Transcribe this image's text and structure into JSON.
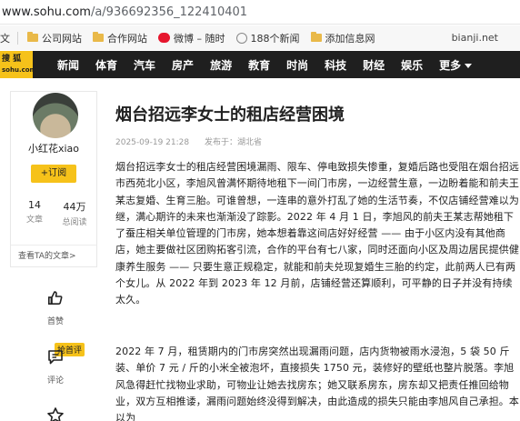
{
  "browser": {
    "address_host": "www.sohu.com",
    "address_path": "/a/936692356_122410401"
  },
  "bookmarks": {
    "left_cut": "文",
    "items": [
      "公司网站",
      "合作网站",
      "微博 – 随时",
      "188个新闻",
      "添加信息网"
    ],
    "right": "bianji.net"
  },
  "nav": {
    "logo_line1": "搜 狐",
    "logo_line2": "sohu.com",
    "links": [
      "新闻",
      "体育",
      "汽车",
      "房产",
      "旅游",
      "教育",
      "时尚",
      "科技",
      "财经",
      "娱乐",
      "更多"
    ]
  },
  "author": {
    "name": "小红花xiao",
    "follow": "+订阅",
    "articles_count": "14",
    "articles_label": "文章",
    "reads_count": "44万",
    "reads_label": "总阅读",
    "more_link": "查看TA的文章>"
  },
  "rail": {
    "like": "首赞",
    "comment_badge": "抢首评",
    "comment": "评论"
  },
  "article": {
    "title": "烟台招远李女士的租店经营困境",
    "date": "2025-09-19 21:28",
    "publisher": "发布于：湖北省",
    "paragraph1": "烟台招远李女士的租店经营困境漏雨、限车、停电致损失惨重，复婚后路也受阻在烟台招远市西苑北小区，李旭风曾满怀期待地租下一间门市房，一边经营生意，一边盼着能和前夫王某志复婚、生育三胎。可谁曾想，一连串的意外打乱了她的生活节奏，不仅店铺经营难以为继，满心期许的未来也渐渐没了踪影。2022 年 4 月 1 日，李旭风的前夫王某志帮她租下了蚕庄相关单位管理的门市房，她本想着靠这间店好好经营 —— 由于小区内没有其他商店，她主要做社区团购拓客引流，合作的平台有七八家，同时还面向小区及周边居民提供健康养生服务 —— 只要生意正规稳定，就能和前夫兑现复婚生三胎的约定，此前两人已有两个女儿。从 2022 年到 2023 年 12 月前，店铺经营还算顺利，可平静的日子并没有持续太久。",
    "paragraph2": "2022 年 7 月，租赁期内的门市房突然出现漏雨问题，店内货物被雨水浸泡，5 袋 50 斤装、单价 7 元 / 斤的小米全被泡坏，直接损失 1750 元，装修好的壁纸也整片脱落。李旭风急得赶忙找物业求助，可物业让她去找房东；她又联系房东，房东却又把责任推回给物业，双方互相推诿，漏雨问题始终没得到解决，由此造成的损失只能由李旭风自己承担。本以为"
  }
}
